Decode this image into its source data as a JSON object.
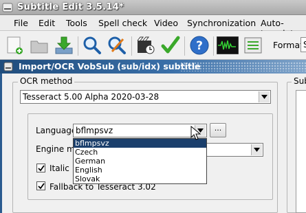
{
  "window": {
    "title": "Subtitle Edit 3.5.14*"
  },
  "menu": [
    "File",
    "Edit",
    "Tools",
    "Spell check",
    "Video",
    "Synchronization",
    "Auto-translat"
  ],
  "toolbar": {
    "format_label": "Format",
    "format_value": "S",
    "buttons": [
      "new-file-icon",
      "open-folder-icon",
      "save-download-icon",
      "find-icon",
      "replace-icon",
      "visual-sync-icon",
      "spell-check-icon",
      "help-icon",
      "waveform-icon",
      "settings-icon"
    ]
  },
  "dialog": {
    "title": "Import/OCR VobSub (sub/idx) subtitle",
    "ocr_method": {
      "group_label": "OCR method",
      "selected": "Tesseract 5.00 Alpha 2020-03-28"
    },
    "language": {
      "label": "Language",
      "selected": "bflmpsvz",
      "more_button": "...",
      "options": [
        "bflmpsvz",
        "Czech",
        "German",
        "English",
        "Slovak"
      ],
      "highlighted": "bflmpsvz"
    },
    "engine_mode": {
      "label": "Engine mo"
    },
    "italic": {
      "label": "Italic",
      "checked": true
    },
    "fallback": {
      "label": "Fallback to Tesseract 3.02",
      "checked": true
    },
    "right_group_label": "Subt"
  },
  "colors": {
    "dialog_title": "#204d7d",
    "selection": "#1b3f6c",
    "check_green": "#3aa82a",
    "help_blue": "#2f6fc9"
  }
}
